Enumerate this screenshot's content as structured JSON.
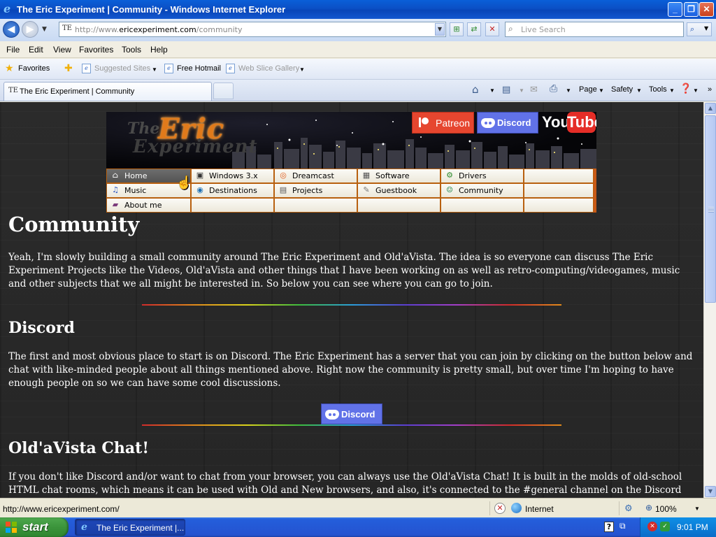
{
  "window": {
    "title": "The Eric Experiment | Community - Windows Internet Explorer"
  },
  "address": {
    "url_prefix": "http://www.",
    "url_domain": "ericexperiment.com",
    "url_path": "/community",
    "search_placeholder": "Live Search"
  },
  "menu": [
    "File",
    "Edit",
    "View",
    "Favorites",
    "Tools",
    "Help"
  ],
  "favorites_bar": {
    "favorites_label": "Favorites",
    "items": [
      {
        "label": "Suggested Sites",
        "enabled": false
      },
      {
        "label": "Free Hotmail",
        "enabled": true
      },
      {
        "label": "Web Slice Gallery",
        "enabled": false
      }
    ]
  },
  "tab": {
    "title": "The Eric Experiment | Community",
    "favicon_text": "TEE"
  },
  "command_bar": {
    "page": "Page",
    "safety": "Safety",
    "tools": "Tools"
  },
  "banner": {
    "logo_the": "The",
    "logo_eric": "Eric",
    "logo_experiment": "Experiment",
    "patreon": "Patreon",
    "discord": "Discord",
    "youtube_you": "You",
    "youtube_tube": "Tube"
  },
  "nav": {
    "rows": [
      [
        {
          "label": "Home",
          "icon": "home-icon",
          "active": true
        },
        {
          "label": "Windows 3.x",
          "icon": "windows-icon"
        },
        {
          "label": "Dreamcast",
          "icon": "dreamcast-swirl-icon"
        },
        {
          "label": "Software",
          "icon": "software-icon"
        },
        {
          "label": "Drivers",
          "icon": "drivers-icon"
        },
        {
          "label": "",
          "icon": ""
        }
      ],
      [
        {
          "label": "Music",
          "icon": "music-icon"
        },
        {
          "label": "Destinations",
          "icon": "destinations-icon"
        },
        {
          "label": "Projects",
          "icon": "projects-icon"
        },
        {
          "label": "Guestbook",
          "icon": "guestbook-icon"
        },
        {
          "label": "Community",
          "icon": "community-icon"
        },
        {
          "label": "",
          "icon": ""
        }
      ],
      [
        {
          "label": "About me",
          "icon": "book-icon"
        },
        {
          "label": "",
          "icon": ""
        },
        {
          "label": "",
          "icon": ""
        },
        {
          "label": "",
          "icon": ""
        },
        {
          "label": "",
          "icon": ""
        },
        {
          "label": "",
          "icon": ""
        }
      ]
    ]
  },
  "content": {
    "heading": "Community",
    "intro": "Yeah, I'm slowly building a small community around The Eric Experiment and Old'aVista. The idea is so everyone can discuss The Eric Experiment Projects like the Videos, Old'aVista and other things that I have been working on as well as retro-computing/videogames, music and other subjects that we all might be interested in. So below you can see where you can go to join.",
    "discord_heading": "Discord",
    "discord_text": "The first and most obvious place to start is on Discord. The Eric Experiment has a server that you can join by clicking on the button below and chat with like-minded people about all things mentioned above. Right now the community is pretty small, but over time I'm hoping to have enough people on so we can have some cool discussions.",
    "discord_button": "Discord",
    "chat_heading": "Old'aVista Chat!",
    "chat_text": "If you don't like Discord and/or want to chat from your browser, you can always use the Old'aVista Chat! It is built in the molds of old-school HTML chat rooms, which means it can be used with Old and New browsers, and also, it's connected to the #general channel on the Discord server, meaning that you can chat with"
  },
  "status_bar": {
    "status_text": "http://www.ericexperiment.com/",
    "zone": "Internet",
    "zoom": "100%"
  },
  "taskbar": {
    "start": "start",
    "task_item": "The Eric Experiment |...",
    "clock": "9:01 PM"
  },
  "colors": {
    "titlebar": "#0b4fc5",
    "page_bg": "#2a2a2a",
    "nav_border": "#c85a16",
    "patreon": "#e6462f",
    "discord": "#6172e8",
    "youtube": "#e52d27"
  }
}
